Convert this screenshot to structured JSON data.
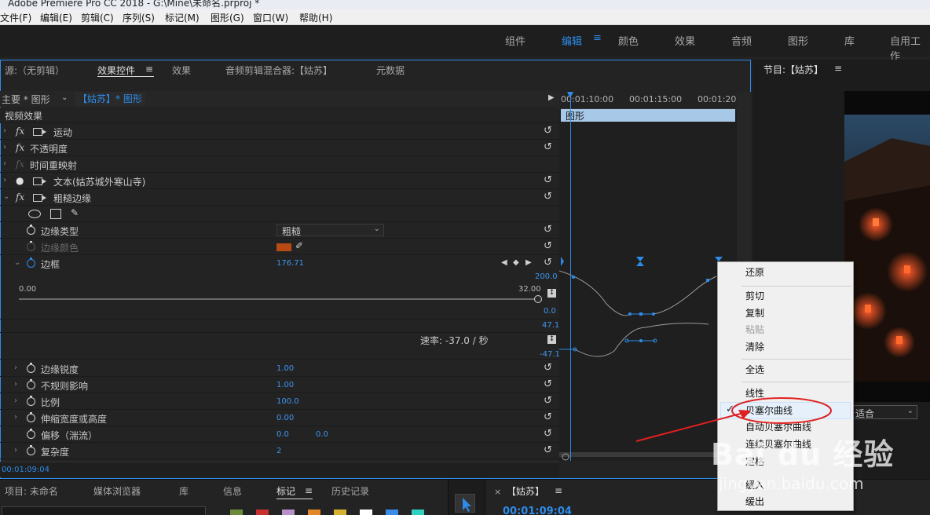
{
  "window": {
    "title": "Adobe Premiere Pro CC 2018 - G:\\Mine\\未命名.prproj *"
  },
  "menu": [
    "文件(F)",
    "编辑(E)",
    "剪辑(C)",
    "序列(S)",
    "标记(M)",
    "图形(G)",
    "窗口(W)",
    "帮助(H)"
  ],
  "workspaces": [
    "组件",
    "编辑",
    "颜色",
    "效果",
    "音频",
    "图形",
    "库",
    "自用工作"
  ],
  "ec": {
    "tabs": [
      "源:（无剪辑）",
      "效果控件",
      "效果",
      "音频剪辑混合器:【姑苏】",
      "元数据"
    ],
    "master_label": "主要 * 图形",
    "clip_label": "【姑苏】* 图形",
    "section": "视频效果",
    "effects": [
      "运动",
      "不透明度",
      "时间重映射",
      "文本(姑苏城外寒山寺)",
      "粗糙边缘"
    ],
    "props": {
      "edge_type": "边缘类型",
      "edge_type_value": "粗糙",
      "edge_color": "边缘颜色",
      "border": "边框",
      "border_value": "176.71",
      "slider_min": "0.00",
      "slider_max": "32.00",
      "graph_top": "200.0",
      "graph_mid": "0.0",
      "graph_v_top": "47.1",
      "graph_v_bot": "-47.1",
      "rate": "速率: -37.0 / 秒",
      "sharpness": "边缘锐度",
      "sharpness_value": "1.00",
      "irregular": "不规则影响",
      "irregular_value": "1.00",
      "scale": "比例",
      "scale_value": "100.0",
      "stretch": "伸缩宽度或高度",
      "stretch_value": "0.00",
      "offset": "偏移（湍流）",
      "offset_x": "0.0",
      "offset_y": "0.0",
      "complexity": "复杂度",
      "complexity_value": "2"
    },
    "timecode": "00:01:09:04",
    "ruler": [
      "00:01:10:00",
      "00:01:15:00",
      "00:01:20:0"
    ],
    "clip_name": "图形"
  },
  "program": {
    "title": "节目:【姑苏】",
    "fit": "适合"
  },
  "bottom": {
    "tabs": [
      "项目: 未命名",
      "媒体浏览器",
      "库",
      "信息",
      "标记",
      "历史记录"
    ],
    "seq_tab": "【姑苏】",
    "seq_timecode": "00:01:09:04",
    "swatches": [
      "#6a8c3a",
      "#c83030",
      "#b890c8",
      "#e0882a",
      "#d8b030",
      "#ffffff",
      "#3a8ae8",
      "#30d0c0"
    ]
  },
  "context_menu": {
    "items": [
      "还原",
      "剪切",
      "复制",
      "粘贴",
      "清除",
      "全选",
      "线性",
      "贝塞尔曲线",
      "自动贝塞尔曲线",
      "连续贝塞尔曲线",
      "定格",
      "缓入",
      "缓出"
    ],
    "checked": "贝塞尔曲线"
  },
  "watermark": {
    "line1": "Bai du 经验",
    "line2": "jingyan.baidu.com"
  },
  "colors": {
    "accent": "#2d8ceb",
    "edge_color_swatch": "#b84a14",
    "annotation": "#e02020"
  }
}
